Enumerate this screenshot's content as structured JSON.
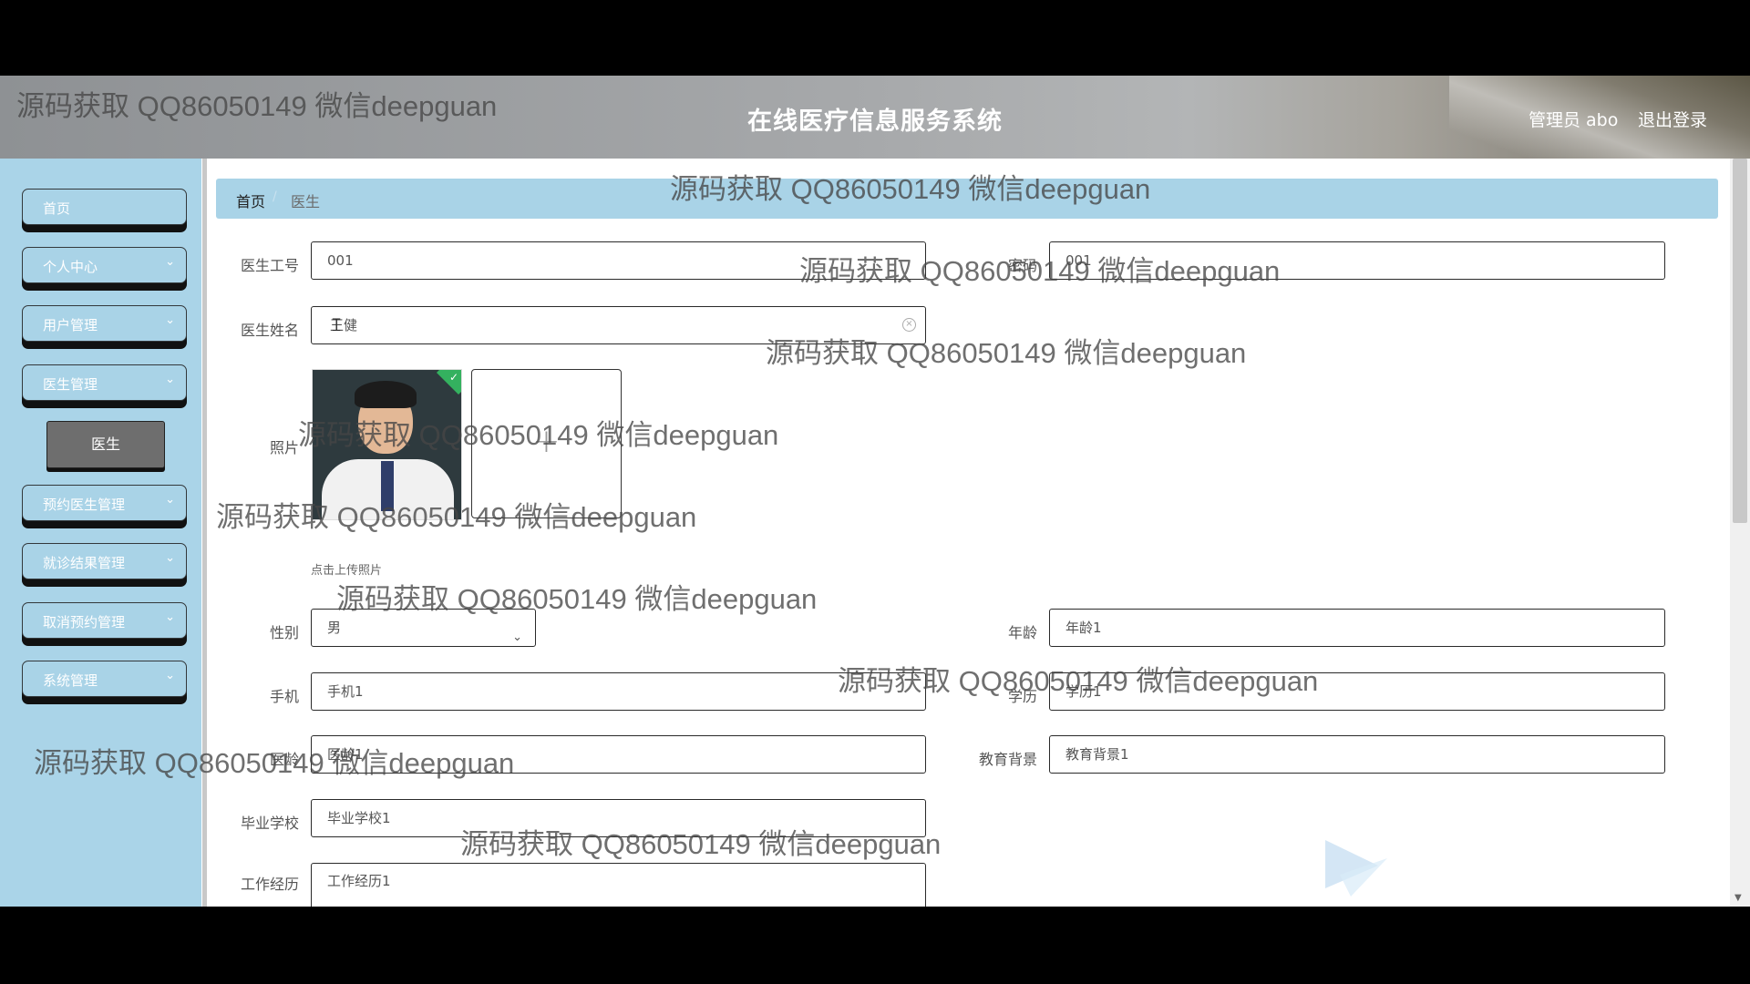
{
  "header": {
    "title": "在线医疗信息服务系统",
    "admin": "管理员 abo",
    "logout": "退出登录"
  },
  "watermark": "源码获取 QQ86050149 微信deepguan",
  "sidebar": {
    "items": [
      {
        "label": "首页"
      },
      {
        "label": "个人中心",
        "chevron": "⌄"
      },
      {
        "label": "用户管理",
        "chevron": "⌄"
      },
      {
        "label": "医生管理",
        "chevron": "⌄"
      },
      {
        "label": "预约医生管理",
        "chevron": "⌄"
      },
      {
        "label": "就诊结果管理",
        "chevron": "⌄"
      },
      {
        "label": "取消预约管理",
        "chevron": "⌄"
      },
      {
        "label": "系统管理",
        "chevron": "⌄"
      }
    ],
    "active_sub": "医生"
  },
  "breadcrumb": {
    "home": "首页",
    "separator": "/",
    "current": "医生"
  },
  "form": {
    "doctor_id": {
      "label": "医生工号",
      "value": "001"
    },
    "password": {
      "label": "密码",
      "value": "001"
    },
    "doctor_name": {
      "label": "医生姓名",
      "value": "王健"
    },
    "photo": {
      "label": "照片",
      "hint": "点击上传照片",
      "plus": "+"
    },
    "gender": {
      "label": "性别",
      "value": "男"
    },
    "age": {
      "label": "年龄",
      "value": "年龄1"
    },
    "phone": {
      "label": "手机",
      "value": "手机1"
    },
    "education": {
      "label": "学历",
      "value": "学历1"
    },
    "years": {
      "label": "医龄",
      "value": "医龄1"
    },
    "edu_background": {
      "label": "教育背景",
      "value": "教育背景1"
    },
    "school": {
      "label": "毕业学校",
      "value": "毕业学校1"
    },
    "experience": {
      "label": "工作经历",
      "value": "工作经历1"
    }
  },
  "colors": {
    "sidebar": "#aad4e8",
    "accent": "#a9d3e7",
    "active": "#6e6e6e"
  }
}
